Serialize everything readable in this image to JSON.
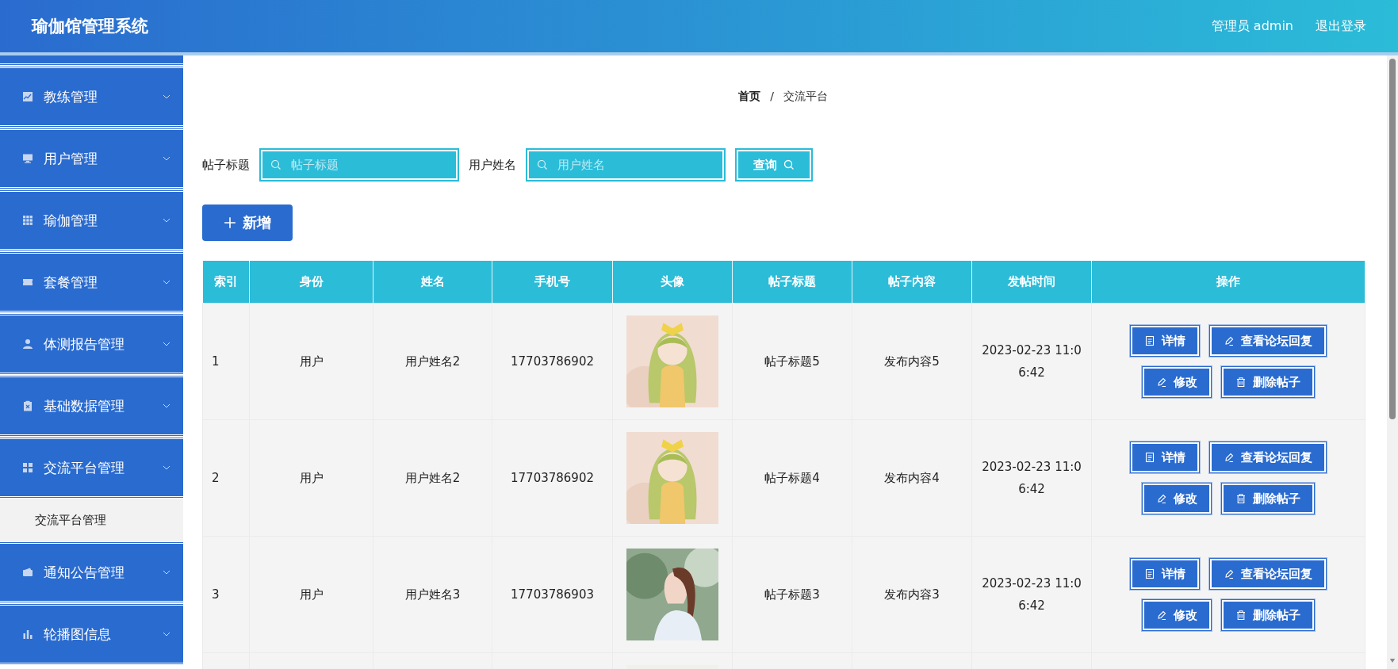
{
  "header": {
    "title": "瑜伽馆管理系统",
    "user": "管理员 admin",
    "logout": "退出登录"
  },
  "sidebar": {
    "items": [
      {
        "label": "教练管理"
      },
      {
        "label": "用户管理"
      },
      {
        "label": "瑜伽管理"
      },
      {
        "label": "套餐管理"
      },
      {
        "label": "体测报告管理"
      },
      {
        "label": "基础数据管理"
      },
      {
        "label": "交流平台管理",
        "children": [
          {
            "label": "交流平台管理"
          }
        ]
      },
      {
        "label": "通知公告管理"
      },
      {
        "label": "轮播图信息"
      }
    ]
  },
  "breadcrumb": [
    "首页",
    "/",
    "交流平台"
  ],
  "search": {
    "fields": [
      {
        "label": "帖子标题",
        "placeholder": "帖子标题"
      },
      {
        "label": "用户姓名",
        "placeholder": "用户姓名"
      }
    ],
    "button": "查询"
  },
  "add_button": "新增",
  "table": {
    "columns": [
      "索引",
      "身份",
      "姓名",
      "手机号",
      "头像",
      "帖子标题",
      "帖子内容",
      "发帖时间",
      "操作"
    ],
    "rows": [
      {
        "index": "1",
        "role": "用户",
        "name": "用户姓名2",
        "phone": "17703786902",
        "avatar": {
          "kind": "picture"
        },
        "title": "帖子标题5",
        "content": "发布内容5",
        "time": "2023-02-23 11:06:42",
        "actions": [
          "详情",
          "查看论坛回复",
          "修改",
          "删除帖子"
        ]
      },
      {
        "index": "2",
        "role": "用户",
        "name": "用户姓名2",
        "phone": "17703786902",
        "avatar": {
          "kind": "picture"
        },
        "title": "帖子标题4",
        "content": "发布内容4",
        "time": "2023-02-23 11:06:42",
        "actions": [
          "详情",
          "查看论坛回复",
          "修改",
          "删除帖子"
        ]
      },
      {
        "index": "3",
        "role": "用户",
        "name": "用户姓名3",
        "phone": "17703786903",
        "avatar": {
          "kind": "picture"
        },
        "title": "帖子标题3",
        "content": "发布内容3",
        "time": "2023-02-23 11:06:42",
        "actions": [
          "详情",
          "查看论坛回复",
          "修改",
          "删除帖子"
        ]
      },
      {
        "avatar": {
          "kind": "picture"
        }
      }
    ]
  }
}
